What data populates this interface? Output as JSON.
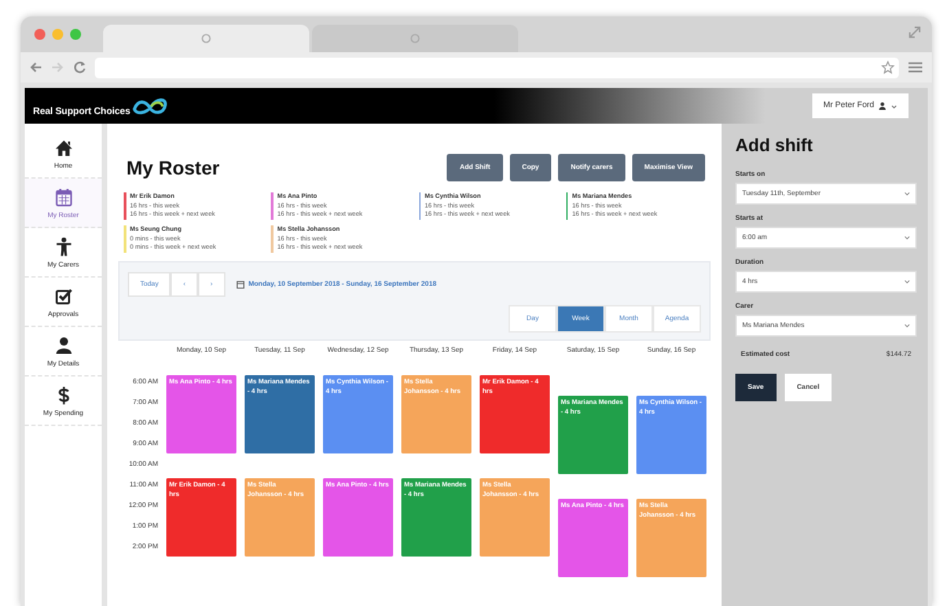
{
  "browser": {
    "tabs": [
      {
        "selected": true
      },
      {
        "selected": false
      }
    ]
  },
  "header": {
    "brand": "Real Support Choices",
    "user": "Mr Peter Ford"
  },
  "nav": [
    {
      "label": "Home",
      "kind": "home",
      "selected": false
    },
    {
      "label": "My Roster",
      "kind": "calendar",
      "selected": true
    },
    {
      "label": "My Carers",
      "kind": "figure",
      "selected": false
    },
    {
      "label": "Approvals",
      "kind": "check",
      "selected": false
    },
    {
      "label": "My Details",
      "kind": "person",
      "selected": false
    },
    {
      "label": "My Spending",
      "kind": "dollar",
      "selected": false
    }
  ],
  "roster": {
    "title": "My Roster",
    "actions": [
      "Add Shift",
      "Copy",
      "Notify carers",
      "Maximise View"
    ],
    "carers": [
      {
        "name": "Mr Erik Damon",
        "color": "#e8505b",
        "lines": [
          "16 hrs - this week",
          "16 hrs - this week + next week"
        ]
      },
      {
        "name": "Ms Ana Pinto",
        "color": "#e27ad8",
        "lines": [
          "16 hrs - this week",
          "16 hrs - this week + next week"
        ]
      },
      {
        "name": "Ms Cynthia Wilson",
        "color": "#8aa6dc",
        "lines": [
          "16 hrs - this week",
          "16 hrs - this week + next week"
        ]
      },
      {
        "name": "Ms Mariana Mendes",
        "color": "#2fae62",
        "lines": [
          "16 hrs - this week",
          "16 hrs - this week + next week"
        ]
      },
      {
        "name": "Ms Seung Chung",
        "color": "#f2e27a",
        "lines": [
          "0 mins - this week",
          "0 mins - this week + next week"
        ]
      },
      {
        "name": "Ms Stella Johansson",
        "color": "#f0c9a0",
        "lines": [
          "16 hrs - this week",
          "16 hrs - this week + next week"
        ]
      }
    ],
    "today": "Today",
    "prev": "‹",
    "next": "›",
    "range": "Monday, 10 September 2018 - Sunday, 16 September 2018",
    "views": [
      {
        "label": "Day",
        "selected": false
      },
      {
        "label": "Week",
        "selected": true
      },
      {
        "label": "Month",
        "selected": false
      },
      {
        "label": "Agenda",
        "selected": false
      }
    ],
    "times": [
      "6:00 AM",
      "7:00 AM",
      "8:00 AM",
      "9:00 AM",
      "10:00 AM",
      "11:00 AM",
      "12:00 PM",
      "1:00 PM",
      "2:00 PM"
    ],
    "days": [
      {
        "label": "Monday, 10 Sep",
        "kind": "weekday",
        "shifts": [
          {
            "label": "Ms Ana Pinto - 4 hrs",
            "color": "#e455e8",
            "kind": "morning"
          },
          {
            "label": "Mr Erik Damon - 4 hrs",
            "color": "#ef2b2b",
            "kind": "midday"
          }
        ]
      },
      {
        "label": "Tuesday, 11 Sep",
        "kind": "weekday",
        "shifts": [
          {
            "label": "Ms Mariana Mendes - 4 hrs",
            "color": "#2f6ea5",
            "kind": "morning"
          },
          {
            "label": "Ms Stella Johansson - 4 hrs",
            "color": "#f5a55a",
            "kind": "midday"
          }
        ]
      },
      {
        "label": "Wednesday, 12 Sep",
        "kind": "weekday",
        "shifts": [
          {
            "label": "Ms Cynthia Wilson - 4 hrs",
            "color": "#5b8ff2",
            "kind": "morning"
          },
          {
            "label": "Ms Ana Pinto - 4 hrs",
            "color": "#e455e8",
            "kind": "midday"
          }
        ]
      },
      {
        "label": "Thursday, 13 Sep",
        "kind": "weekday",
        "shifts": [
          {
            "label": "Ms Stella Johansson - 4 hrs",
            "color": "#f5a55a",
            "kind": "morning"
          },
          {
            "label": "Ms Mariana Mendes - 4 hrs",
            "color": "#21a04a",
            "kind": "midday"
          }
        ]
      },
      {
        "label": "Friday, 14 Sep",
        "kind": "weekday",
        "shifts": [
          {
            "label": "Mr Erik Damon - 4 hrs",
            "color": "#ef2b2b",
            "kind": "morning"
          },
          {
            "label": "Ms Stella Johansson - 4 hrs",
            "color": "#f5a55a",
            "kind": "midday"
          }
        ]
      },
      {
        "label": "Saturday, 15 Sep",
        "kind": "weekend",
        "shifts": [
          {
            "label": "Ms Mariana Mendes - 4 hrs",
            "color": "#21a04a",
            "kind": "morning"
          },
          {
            "label": "Ms Ana Pinto - 4 hrs",
            "color": "#e455e8",
            "kind": "midday"
          }
        ]
      },
      {
        "label": "Sunday, 16 Sep",
        "kind": "weekend",
        "shifts": [
          {
            "label": "Ms Cynthia Wilson - 4 hrs",
            "color": "#5b8ff2",
            "kind": "morning"
          },
          {
            "label": "Ms Stella Johansson - 4 hrs",
            "color": "#f5a55a",
            "kind": "midday"
          }
        ]
      }
    ]
  },
  "panel": {
    "title": "Add shift",
    "fields": [
      {
        "label": "Starts on",
        "value": "Tuesday 11th, September"
      },
      {
        "label": "Starts at",
        "value": "6:00 am"
      },
      {
        "label": "Duration",
        "value": "4 hrs"
      },
      {
        "label": "Carer",
        "value": "Ms Mariana Mendes"
      }
    ],
    "cost": {
      "label": "Estimated cost",
      "value": "$144.72"
    },
    "buttons": [
      {
        "label": "Save",
        "kind": "primary"
      },
      {
        "label": "Cancel",
        "kind": "secondary"
      }
    ]
  }
}
